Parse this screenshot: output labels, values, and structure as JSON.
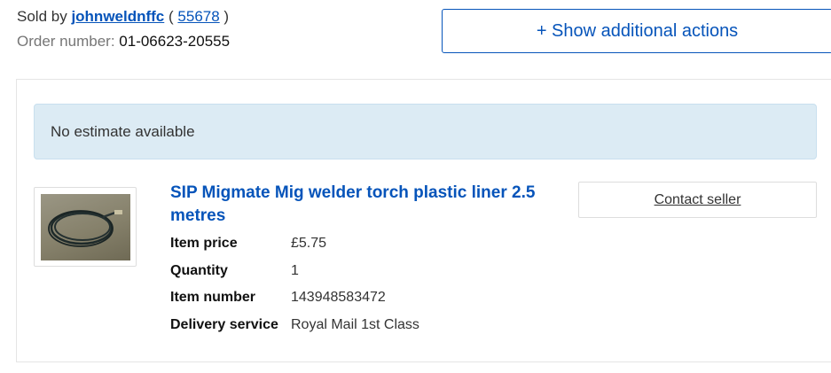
{
  "seller": {
    "prefix": "Sold by",
    "name": "johnweldnffc",
    "feedback_open": "(",
    "feedback_score": "55678",
    "feedback_close": ")"
  },
  "order": {
    "label": "Order number:",
    "number": "01-06623-20555"
  },
  "actions_button": "+ Show additional actions",
  "estimate_message": "No estimate available",
  "item": {
    "title": "SIP Migmate Mig welder torch plastic liner 2.5 metres",
    "details": [
      {
        "label": "Item price",
        "value": "£5.75"
      },
      {
        "label": "Quantity",
        "value": "1"
      },
      {
        "label": "Item number",
        "value": "143948583472"
      },
      {
        "label": "Delivery service",
        "value": "Royal Mail 1st Class"
      }
    ]
  },
  "contact_seller": "Contact seller"
}
